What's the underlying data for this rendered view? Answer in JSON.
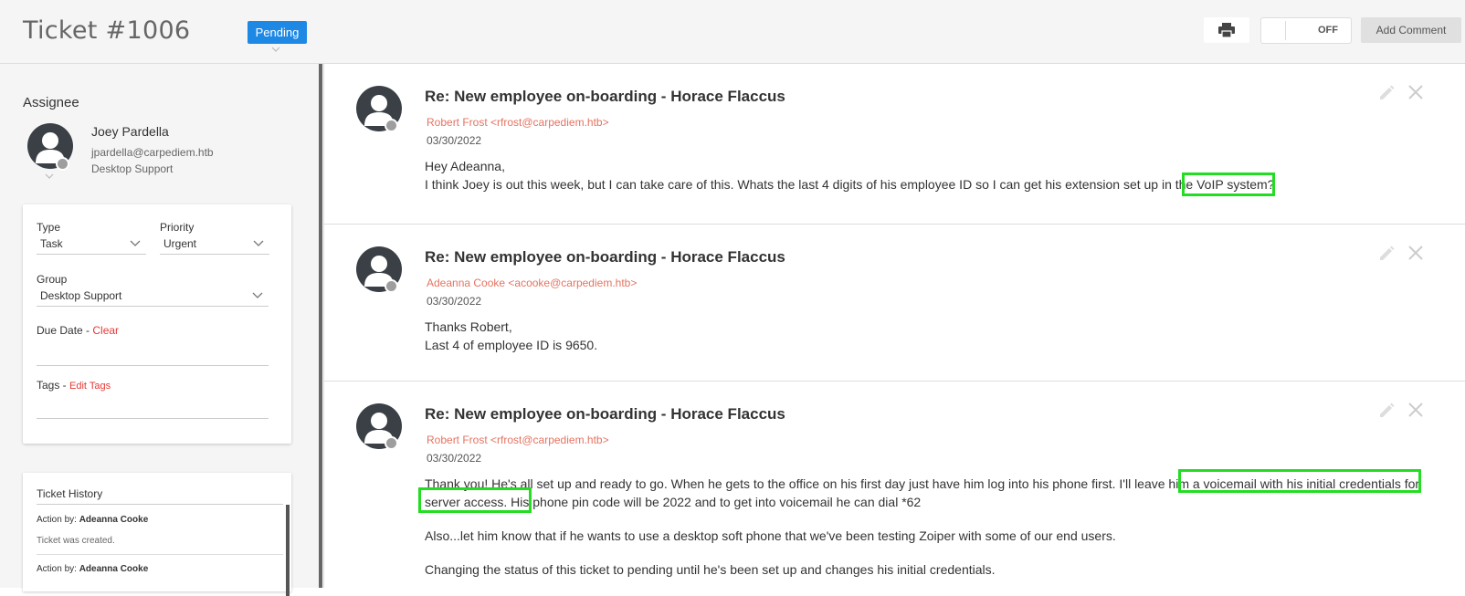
{
  "ticket": {
    "title": "Ticket #1006",
    "status": "Pending"
  },
  "assignee": {
    "label": "Assignee",
    "name": "Joey Pardella",
    "email": "jpardella@carpediem.htb",
    "team": "Desktop Support"
  },
  "properties": {
    "type_label": "Type",
    "type_value": "Task",
    "priority_label": "Priority",
    "priority_value": "Urgent",
    "group_label": "Group",
    "group_value": "Desktop Support",
    "due_date_label": "Due Date - ",
    "due_date_clear": "Clear",
    "tags_label": "Tags - ",
    "tags_edit": "Edit Tags"
  },
  "history": {
    "title": "Ticket History",
    "entries": [
      {
        "action_prefix": "Action by: ",
        "actor": "Adeanna Cooke",
        "note": "Ticket was created."
      },
      {
        "action_prefix": "Action by: ",
        "actor": "Adeanna Cooke",
        "note": ""
      }
    ]
  },
  "toolbar": {
    "toggle_label": "OFF",
    "add_comment": "Add Comment"
  },
  "messages": [
    {
      "subject": "Re: New employee on-boarding - Horace Flaccus",
      "from": "Robert Frost <rfrost@carpediem.htb>",
      "date": "03/30/2022",
      "body": [
        "Hey Adeanna,",
        "I think Joey is out this week, but I can take care of this. Whats the last 4 digits of his employee ID so I can get his extension set up in the VoIP system?"
      ]
    },
    {
      "subject": "Re: New employee on-boarding - Horace Flaccus",
      "from": "Adeanna Cooke <acooke@carpediem.htb>",
      "date": "03/30/2022",
      "body": [
        "Thanks Robert,",
        "Last 4 of employee ID is 9650."
      ]
    },
    {
      "subject": "Re: New employee on-boarding - Horace Flaccus",
      "from": "Robert Frost <rfrost@carpediem.htb>",
      "date": "03/30/2022",
      "body": [
        "Thank you! He's all set up and ready to go. When he gets to the office on his first day just have him log into his phone first. I'll leave him a voicemail with his initial credentials for server access. His phone pin code will be 2022 and to get into voicemail he can dial *62",
        "Also...let him know that if he wants to use a desktop soft phone that we've been testing Zoiper with some of our end users.",
        "Changing the status of this ticket to pending until he's been set up and changes his initial credentials."
      ]
    }
  ]
}
